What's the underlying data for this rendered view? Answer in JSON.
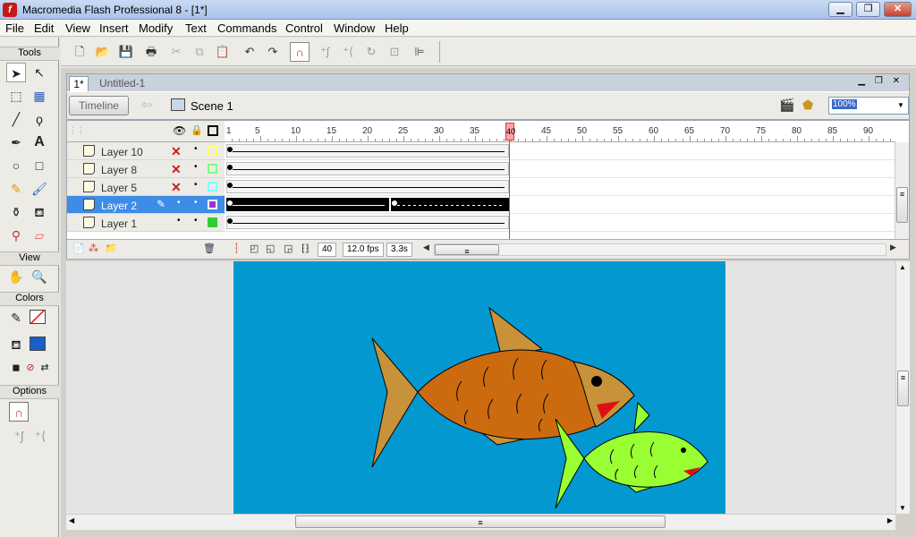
{
  "window": {
    "title": "Macromedia Flash Professional 8 - [1*]",
    "app_icon": "f",
    "controls": [
      "minimize",
      "maximize",
      "close"
    ]
  },
  "menu": [
    "File",
    "Edit",
    "View",
    "Insert",
    "Modify",
    "Text",
    "Commands",
    "Control",
    "Window",
    "Help"
  ],
  "tools_panel": {
    "title": "Tools",
    "view_label": "View",
    "colors_label": "Colors",
    "options_label": "Options"
  },
  "document": {
    "tabs": [
      "1*",
      "Untitled-1"
    ],
    "timeline_button": "Timeline",
    "scene": "Scene 1",
    "zoom": "100%"
  },
  "timeline": {
    "ruler_numbers": [
      "1",
      "5",
      "10",
      "15",
      "20",
      "25",
      "30",
      "35",
      "40",
      "45",
      "50",
      "55",
      "60",
      "65",
      "70",
      "75",
      "80",
      "85",
      "90"
    ],
    "layers": [
      {
        "name": "Layer 10",
        "hidden": true,
        "color": "#ffff80"
      },
      {
        "name": "Layer 8",
        "hidden": true,
        "color": "#80ff80"
      },
      {
        "name": "Layer 5",
        "hidden": true,
        "color": "#80ffff"
      },
      {
        "name": "Layer 2",
        "hidden": false,
        "selected": true,
        "color": "#9933cc"
      },
      {
        "name": "Layer 1",
        "hidden": false,
        "color": "#33cc33"
      }
    ],
    "current_frame": "40",
    "frame_rate": "12.0 fps",
    "elapsed": "3.3s",
    "playhead_marker": "40"
  },
  "stage": {
    "background": "#0398d0",
    "big_fish_body": "#cc6a10",
    "big_fish_fins": "#c8923a",
    "small_fish_body": "#99ff33",
    "mouth": "#dd1111"
  }
}
